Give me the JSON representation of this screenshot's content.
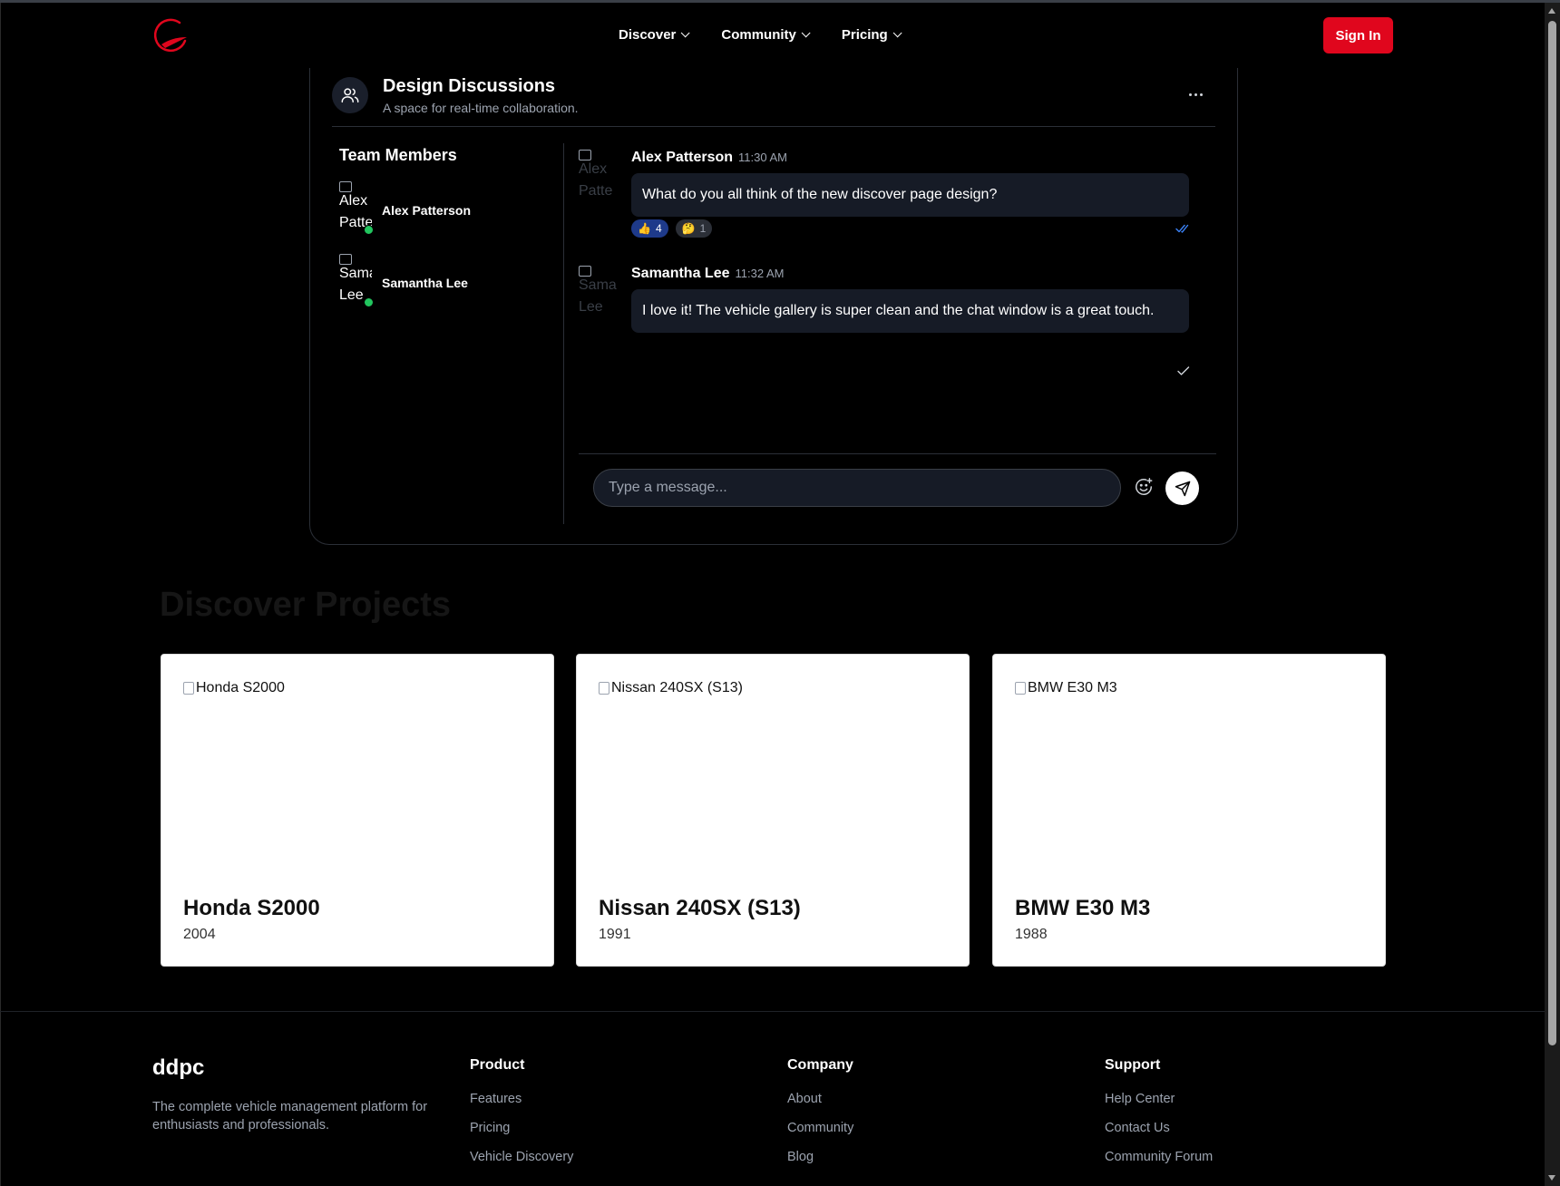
{
  "nav": {
    "items": [
      {
        "label": "Discover"
      },
      {
        "label": "Community"
      },
      {
        "label": "Pricing"
      }
    ],
    "signin_label": "Sign In"
  },
  "chat": {
    "title": "Design Discussions",
    "subtitle": "A space for real-time collaboration.",
    "members_title": "Team Members",
    "members": [
      {
        "name": "Alex Patterson",
        "avatar_alt": "Alex Patte",
        "online": true
      },
      {
        "name": "Samantha Lee",
        "avatar_alt": "Sama Lee",
        "online": true
      }
    ],
    "messages": [
      {
        "author": "Alex Patterson",
        "time": "11:30 AM",
        "avatar_alt": "Alex Patte",
        "text": "What do you all think of the new discover page design?",
        "reactions": [
          {
            "emoji": "👍",
            "count": "4"
          },
          {
            "emoji": "🤔",
            "count": "1"
          }
        ],
        "read_status": "read"
      },
      {
        "author": "Samantha Lee",
        "time": "11:32 AM",
        "avatar_alt": "Sama Lee",
        "text": "I love it! The vehicle gallery is super clean and the chat window is a great touch.",
        "read_status": "sent"
      }
    ],
    "composer_placeholder": "Type a message..."
  },
  "discover": {
    "title": "Discover Projects",
    "cards": [
      {
        "alt": "Honda S2000",
        "title": "Honda S2000",
        "year": "2004"
      },
      {
        "alt": "Nissan 240SX (S13)",
        "title": "Nissan 240SX (S13)",
        "year": "1991"
      },
      {
        "alt": "BMW E30 M3",
        "title": "BMW E30 M3",
        "year": "1988"
      }
    ]
  },
  "footer": {
    "brand": "ddpc",
    "description": "The complete vehicle management platform for enthusiasts and professionals.",
    "columns": [
      {
        "heading": "Product",
        "links": [
          "Features",
          "Pricing",
          "Vehicle Discovery"
        ]
      },
      {
        "heading": "Company",
        "links": [
          "About",
          "Community",
          "Blog"
        ]
      },
      {
        "heading": "Support",
        "links": [
          "Help Center",
          "Contact Us",
          "Community Forum"
        ]
      }
    ]
  },
  "colors": {
    "accent": "#e0061d",
    "background": "#000000",
    "bubble": "#161b26",
    "online": "#22c55e",
    "read_check": "#3b82f6"
  }
}
